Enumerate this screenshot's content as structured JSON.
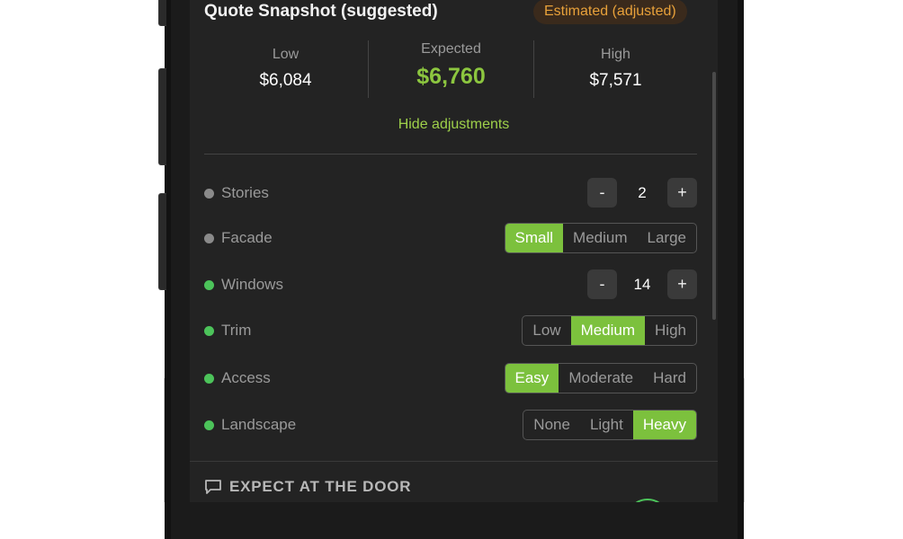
{
  "card": {
    "title": "Quote Snapshot (suggested)",
    "badge": "Estimated (adjusted)",
    "badge_color": "#e8a13a",
    "prices": {
      "low_label": "Low",
      "low_value": "$6,084",
      "expected_label": "Expected",
      "expected_value": "$6,760",
      "high_label": "High",
      "high_value": "$7,571"
    },
    "toggle_link": "Hide adjustments"
  },
  "adjustments": {
    "stories": {
      "label": "Stories",
      "value": "2",
      "minus": "-",
      "plus": "+"
    },
    "facade": {
      "label": "Facade",
      "options": [
        "Small",
        "Medium",
        "Large"
      ],
      "selected": "Small"
    },
    "windows": {
      "label": "Windows",
      "value": "14",
      "minus": "-",
      "plus": "+"
    },
    "trim": {
      "label": "Trim",
      "options": [
        "Low",
        "Medium",
        "High"
      ],
      "selected": "Medium"
    },
    "access": {
      "label": "Access",
      "options": [
        "Easy",
        "Moderate",
        "Hard"
      ],
      "selected": "Easy"
    },
    "landscape": {
      "label": "Landscape",
      "options": [
        "None",
        "Light",
        "Heavy"
      ],
      "selected": "Heavy"
    }
  },
  "expect": {
    "title": "EXPECT AT THE DOOR",
    "icon": "chat-bubble-icon"
  },
  "colors": {
    "accent_green": "#7cc13d",
    "expected_green": "#8cc63f",
    "dot_green": "#4cc35a",
    "dot_grey": "#8a8a8a",
    "screen_bg": "#232323"
  }
}
